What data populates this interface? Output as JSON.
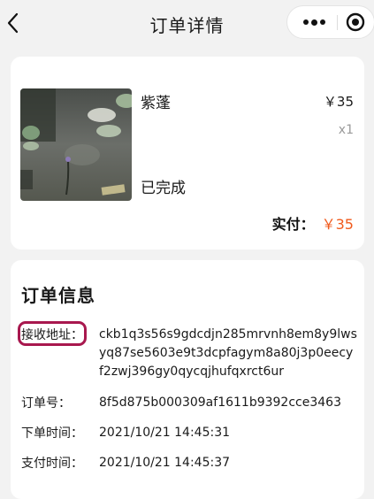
{
  "nav": {
    "title": "订单详情"
  },
  "product": {
    "name": "紫蓬",
    "price": "￥35",
    "qty": "x1",
    "status": "已完成",
    "paid_label": "实付：",
    "paid_amount": "￥35"
  },
  "order_info": {
    "title": "订单信息",
    "address_label": "接收地址：",
    "address": "ckb1q3s56s9gdcdjn285mrvnh8em8y9lwsyq87se5603e9t3dcpfagym8a80j3p0eecyf2zwj396gy0qycqjhufqxrct6ur",
    "order_no_label": "订单号：",
    "order_no": "8f5d875b000309af1611b9392cce3463",
    "created_label": "下单时间：",
    "created": "2021/10/21 14:45:31",
    "paid_time_label": "支付时间：",
    "paid_time": "2021/10/21 14:45:37"
  },
  "colors": {
    "accent": "#f05a1c",
    "highlight": "#a8184e"
  },
  "icons": {
    "back": "chevron-left-icon",
    "more": "more-dots-icon",
    "close": "target-circle-icon"
  }
}
